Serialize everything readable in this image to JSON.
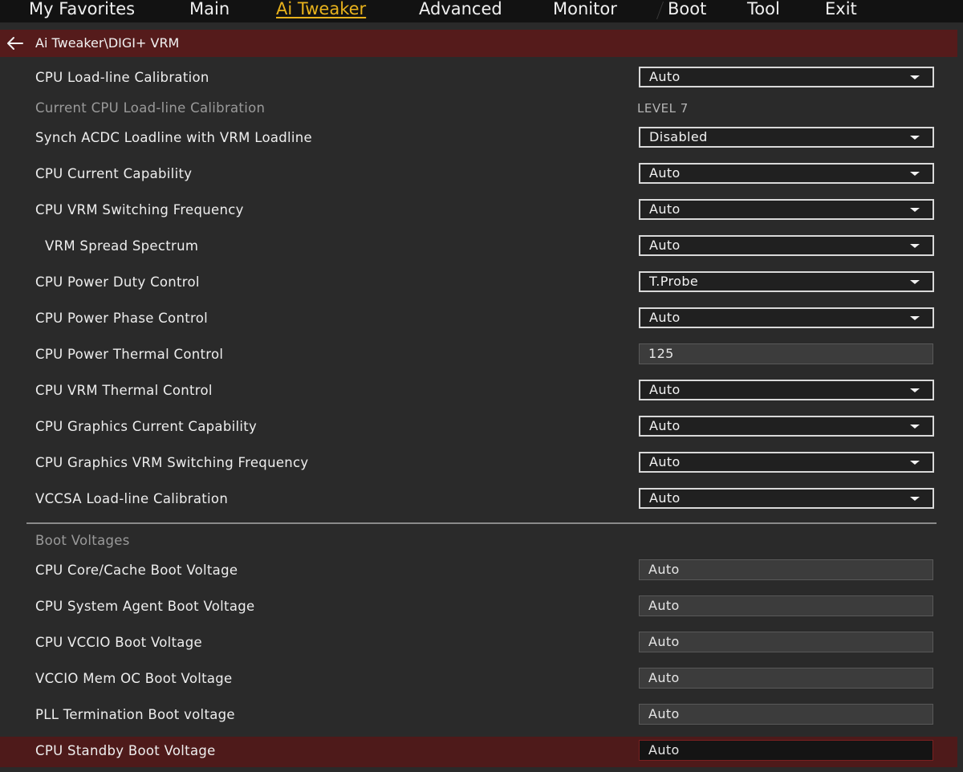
{
  "menu": {
    "tabs": [
      {
        "label": "My Favorites"
      },
      {
        "label": "Main"
      },
      {
        "label": "Ai Tweaker"
      },
      {
        "label": "Advanced"
      },
      {
        "label": "Monitor"
      },
      {
        "label": "Boot"
      },
      {
        "label": "Tool"
      },
      {
        "label": "Exit"
      }
    ],
    "active_tab": "Ai Tweaker"
  },
  "breadcrumb": {
    "icon": "arrow-left-icon",
    "path": "Ai Tweaker\\DIGI+ VRM"
  },
  "settings": [
    {
      "label": "CPU Load-line Calibration",
      "value": "Auto"
    },
    {
      "label": "Current CPU Load-line Calibration",
      "value": "LEVEL 7"
    },
    {
      "label": "Synch ACDC Loadline with VRM Loadline",
      "value": "Disabled"
    },
    {
      "label": "CPU Current Capability",
      "value": "Auto"
    },
    {
      "label": "CPU VRM Switching Frequency",
      "value": "Auto"
    },
    {
      "label": "VRM Spread Spectrum",
      "value": "Auto"
    },
    {
      "label": "CPU Power Duty Control",
      "value": "T.Probe"
    },
    {
      "label": "CPU Power Phase Control",
      "value": "Auto"
    },
    {
      "label": "CPU Power Thermal Control",
      "value": "125"
    },
    {
      "label": "CPU VRM Thermal Control",
      "value": "Auto"
    },
    {
      "label": "CPU Graphics Current Capability",
      "value": "Auto"
    },
    {
      "label": "CPU Graphics VRM Switching Frequency",
      "value": "Auto"
    },
    {
      "label": "VCCSA Load-line Calibration",
      "value": "Auto"
    }
  ],
  "boot_voltages": {
    "title": "Boot Voltages",
    "items": [
      {
        "label": "CPU Core/Cache Boot Voltage",
        "value": "Auto"
      },
      {
        "label": "CPU System Agent Boot Voltage",
        "value": "Auto"
      },
      {
        "label": "CPU VCCIO Boot Voltage",
        "value": "Auto"
      },
      {
        "label": "VCCIO Mem OC Boot Voltage",
        "value": "Auto"
      },
      {
        "label": "PLL Termination Boot voltage",
        "value": "Auto"
      },
      {
        "label": "CPU Standby Boot Voltage",
        "value": "Auto"
      }
    ]
  },
  "colors": {
    "background": "#2a2a2a",
    "menubar": "#121212",
    "accent_tab": "#e8b21c",
    "highlight": "#551b1b"
  }
}
